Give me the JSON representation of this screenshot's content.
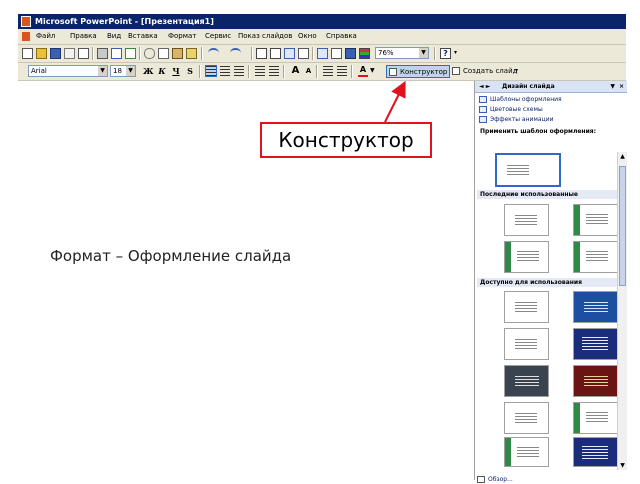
{
  "window": {
    "title": "Microsoft PowerPoint - [Презентация1]"
  },
  "menu": [
    "Файл",
    "Правка",
    "Вид",
    "Вставка",
    "Формат",
    "Сервис",
    "Показ слайдов",
    "Окно",
    "Справка"
  ],
  "toolbar_standard": {
    "zoom": "76%",
    "help_icon_text": "?"
  },
  "toolbar_formatting": {
    "font": "Arial",
    "size": "18",
    "bold": "Ж",
    "italic": "К",
    "underline": "Ч",
    "shadow": "S",
    "grow_font": "A",
    "shrink_font": "A",
    "font_color": "A",
    "design_button": "Конструктор",
    "new_slide_button": "Создать слайд"
  },
  "task_pane": {
    "title": "Дизайн слайда",
    "links": [
      "Шаблоны оформления",
      "Цветовые схемы",
      "Эффекты анимации"
    ],
    "section_apply": "Применить шаблон оформления:",
    "section_recent": "Последние использованные",
    "section_available": "Доступно для использования",
    "browse": "Обзор..."
  },
  "annotation": {
    "label": "Конструктор"
  },
  "caption": "Формат – Оформление слайда",
  "colors": {
    "titlebar": "#0a246a",
    "annotation_border": "#e0131c",
    "arrow": "#e0131c",
    "toolbar_bg": "#ece9d8"
  }
}
